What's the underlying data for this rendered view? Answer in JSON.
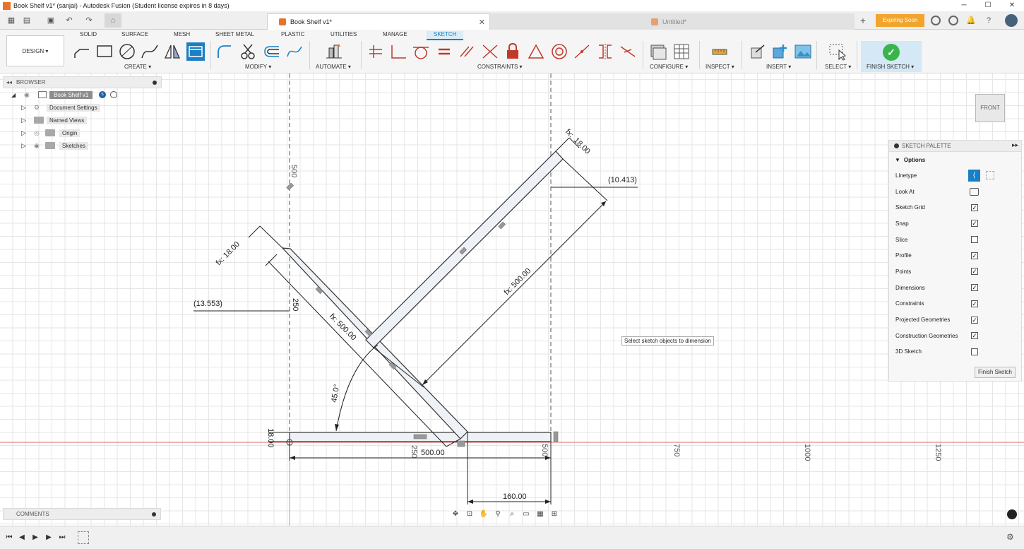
{
  "window": {
    "title": "Book Shelf v1* (sanjai) - Autodesk Fusion (Student license expires in 8 days)"
  },
  "tabs": {
    "active": "Book Shelf v1*",
    "inactive": "Untitled*",
    "expiring": "Expiring Soon"
  },
  "toolbar": {
    "workspace_tabs": [
      "SOLID",
      "SURFACE",
      "MESH",
      "SHEET METAL",
      "PLASTIC",
      "UTILITIES",
      "MANAGE",
      "SKETCH"
    ],
    "active_workspace_tab": "SKETCH",
    "design": "DESIGN ▾",
    "groups": {
      "create": "CREATE ▾",
      "modify": "MODIFY ▾",
      "automate": "AUTOMATE ▾",
      "constraints": "CONSTRAINTS ▾",
      "configure": "CONFIGURE ▾",
      "inspect": "INSPECT ▾",
      "insert": "INSERT ▾",
      "select": "SELECT ▾",
      "finish_sketch": "FINISH SKETCH ▾"
    },
    "accent_color": "#1a7fc3"
  },
  "browser": {
    "title": "BROWSER",
    "root": "Book Shelf v1",
    "items": [
      "Document Settings",
      "Named Views",
      "Origin",
      "Sketches"
    ]
  },
  "sketch_palette": {
    "title": "SKETCH PALETTE",
    "section": "Options",
    "linetype_label": "Linetype",
    "look_at_label": "Look At",
    "options": [
      {
        "label": "Sketch Grid",
        "checked": true
      },
      {
        "label": "Snap",
        "checked": true
      },
      {
        "label": "Slice",
        "checked": false
      },
      {
        "label": "Profile",
        "checked": true
      },
      {
        "label": "Points",
        "checked": true
      },
      {
        "label": "Dimensions",
        "checked": true
      },
      {
        "label": "Constraints",
        "checked": true
      },
      {
        "label": "Projected Geometries",
        "checked": true
      },
      {
        "label": "Construction Geometries",
        "checked": true
      },
      {
        "label": "3D Sketch",
        "checked": false
      }
    ],
    "finish_button": "Finish Sketch"
  },
  "view_cube": {
    "label": "FRONT"
  },
  "tooltip": "Select sketch objects to dimension",
  "comments": {
    "title": "COMMENTS"
  },
  "dimensions": {
    "d_18_top": "18.00",
    "d_fx_top": "fx:",
    "d_10413": "(10.413)",
    "d_fx500_right": "fx: 500.00",
    "d_fx18_left": "fx: 18.00",
    "d_13553": "(13.553)",
    "d_250": "250",
    "d_fx500_left": "fx: 500.00",
    "d_45": "45.0°",
    "d_18_bottom": "18.00",
    "d_500_bottom": "500.00",
    "d_160": "160.00",
    "d_500_axis_top": "500",
    "d_500_axis": "500",
    "d_250_axis": "250"
  },
  "axis_labels": {
    "a750": "750",
    "a1000": "1000",
    "a1250": "1250"
  }
}
